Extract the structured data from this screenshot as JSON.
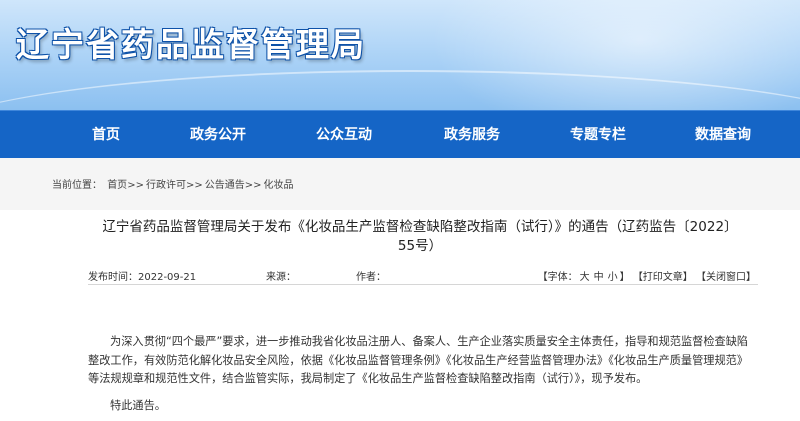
{
  "header": {
    "site_title": "辽宁省药品监督管理局"
  },
  "nav": {
    "items": [
      {
        "label": "首页"
      },
      {
        "label": "政务公开"
      },
      {
        "label": "公众互动"
      },
      {
        "label": "政务服务"
      },
      {
        "label": "专题专栏"
      },
      {
        "label": "数据查询"
      }
    ]
  },
  "breadcrumb": {
    "prefix": "当前位置：",
    "items": [
      "首页",
      "行政许可",
      "公告通告",
      "化妆品"
    ],
    "separator": ">>"
  },
  "article": {
    "title": "辽宁省药品监督管理局关于发布《化妆品生产监督检查缺陷整改指南（试行）》的通告（辽药监告〔2022〕55号）",
    "meta": {
      "date_label": "发布时间：",
      "date": "2022-09-21",
      "source_label": "来源：",
      "source": "",
      "author_label": "作者：",
      "author": "",
      "font_label": "【字体：",
      "font_large": "大",
      "font_medium": "中",
      "font_small": "小",
      "font_close": "】",
      "print": "【打印文章】",
      "close": "【关闭窗口】"
    },
    "paragraphs": [
      "为深入贯彻“四个最严”要求，进一步推动我省化妆品注册人、备案人、生产企业落实质量安全主体责任，指导和规范监督检查缺陷整改工作，有效防范化解化妆品安全风险，依据《化妆品监督管理条例》《化妆品生产经营监督管理办法》《化妆品生产质量管理规范》等法规规章和规范性文件，结合监管实际，我局制定了《化妆品生产监督检查缺陷整改指南（试行）》，现予发布。",
      "特此通告。"
    ]
  },
  "colors": {
    "nav_bg": "#1565c6",
    "banner_top": "#cfe6fb",
    "banner_bottom": "#8cc0f0",
    "title_outline": "#0e52a8"
  }
}
